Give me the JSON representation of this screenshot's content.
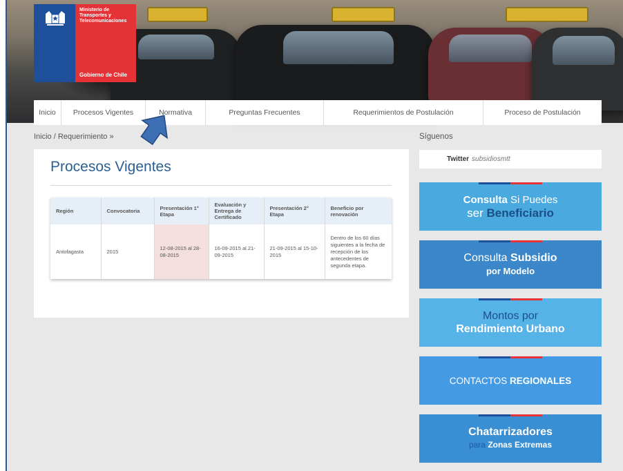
{
  "logo": {
    "ministry": "Ministerio de Transportes y Telecomunicaciones",
    "government": "Gobierno de Chile",
    "crest_icon": "chile-coat-of-arms-icon"
  },
  "nav": {
    "items": [
      {
        "label": "Inicio"
      },
      {
        "label": "Procesos Vigentes"
      },
      {
        "label": "Normativa"
      },
      {
        "label": "Preguntas Frecuentes"
      },
      {
        "label": "Requerimientos de Postulación"
      },
      {
        "label": "Proceso de Postulación"
      }
    ]
  },
  "breadcrumb": "Inicio / Requerimiento »",
  "main": {
    "title": "Procesos Vigentes",
    "table": {
      "headers": [
        "Región",
        "Convocatoria",
        "Presentación 1° Etapa",
        "Evaluación y Entrega de Certificado",
        "Presentación 2° Etapa",
        "Beneficio por renovación"
      ],
      "rows": [
        [
          "Antofagasta",
          "2015",
          "12-08-2015 al 28-08-2015",
          "16-09-2015 al 21-09-2015",
          "21-09-2015 al 15-10-2015",
          "Dentro de los 60 días siguientes a la fecha de recepción de los antecedentes de segunda etapa."
        ]
      ]
    }
  },
  "sidebar": {
    "follow_label": "Síguenos",
    "twitter_label": "Twitter",
    "twitter_handle": "subsidiosmtt",
    "promos": [
      {
        "a": "Consulta",
        "b": " Si Puedes",
        "c": "ser ",
        "d": "Beneficiario"
      },
      {
        "a": "Consulta ",
        "b": "Subsidio",
        "c": "por Modelo"
      },
      {
        "a": "Montos por",
        "b": "Rendimiento Urbano"
      },
      {
        "a": "CONTACTOS ",
        "b": "REGIONALES"
      },
      {
        "a": "Chatarrizadores",
        "b": "para",
        "c": " Zonas Extremas"
      }
    ]
  },
  "colors": {
    "brand_blue": "#1d4f9a",
    "brand_red": "#e43237",
    "title_blue": "#2a5f93"
  }
}
